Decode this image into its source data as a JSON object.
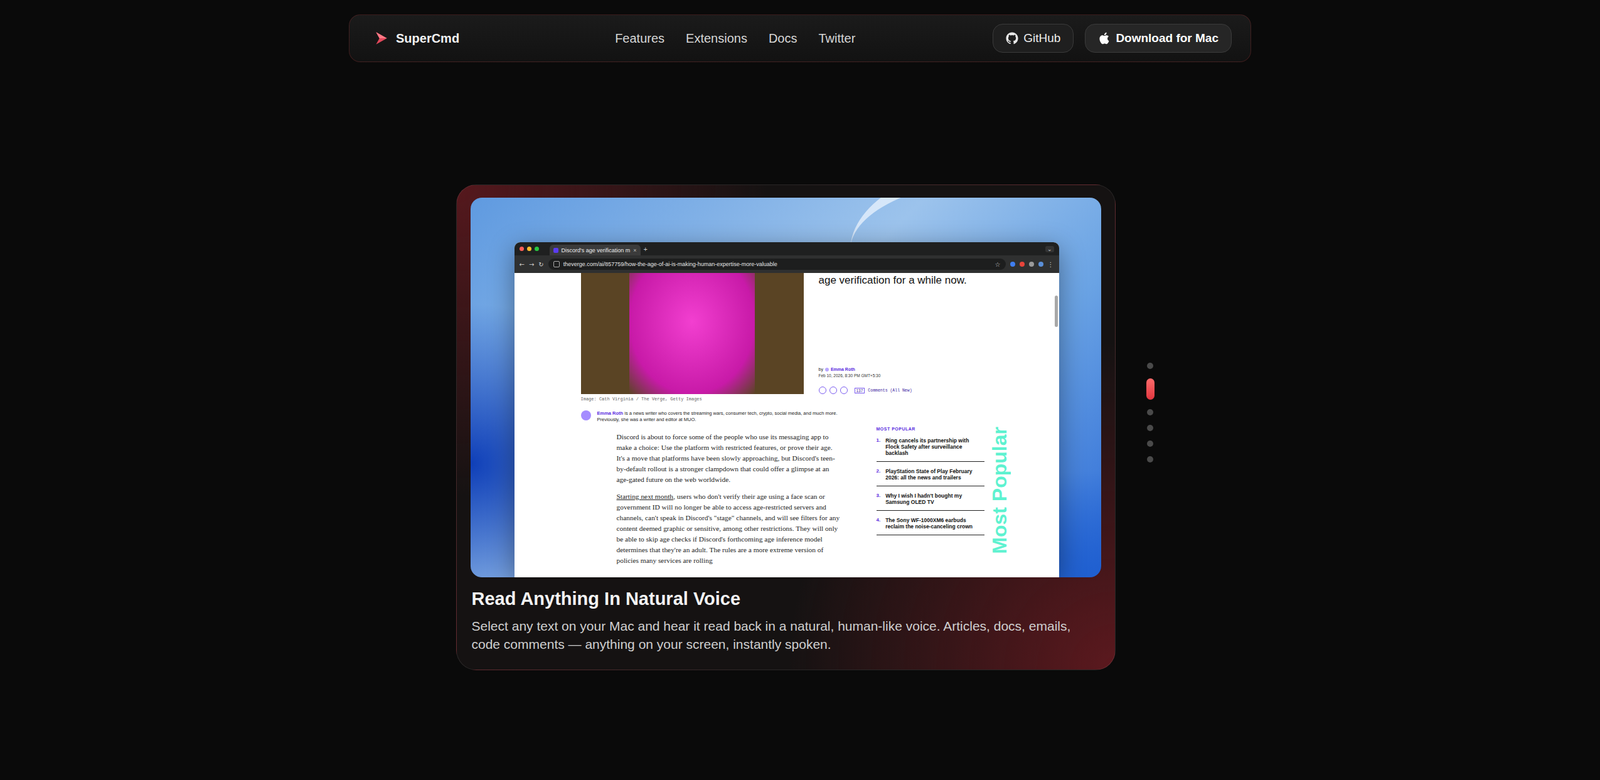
{
  "brand": {
    "name": "SuperCmd"
  },
  "nav": {
    "links": [
      "Features",
      "Extensions",
      "Docs",
      "Twitter"
    ]
  },
  "actions": [
    {
      "label": "GitHub",
      "kind": "github"
    },
    {
      "label": "Download for Mac",
      "kind": "download"
    }
  ],
  "slides": [
    {
      "selected": false
    },
    {
      "selected": true
    },
    {
      "selected": false
    },
    {
      "selected": false
    },
    {
      "selected": false
    },
    {
      "selected": false
    }
  ],
  "feature": {
    "title": "Read Anything In Natural Voice",
    "description": "Select any text on your Mac and hear it read back in a natural, human-like voice. Articles, docs, emails, code comments — anything on your screen, instantly spoken."
  },
  "browser": {
    "tab": {
      "title": "Discord's age verification m",
      "close": "×"
    },
    "new_tab": "+",
    "menu": "⌄",
    "nav_buttons": [
      "←",
      "→",
      "↻"
    ],
    "url": "theverge.com/ai/857759/how-the-age-of-ai-is-making-human-expertise-more-valuable",
    "bookmark": "☆",
    "more": "⋮",
    "article": {
      "headline_tail": "age verification for a while now.",
      "caption": "Image: Cath Virginia / The Verge, Getty Images",
      "byline_prefix": "by",
      "author": "Emma Roth",
      "date": "Feb 10, 2026, 8:30 PM GMT+5:30",
      "comments_count": "137",
      "comments_label": "Comments (All New)",
      "author_bio": "is a news writer who covers the streaming wars, consumer tech, crypto, social media, and much more. Previously, she was a writer and editor at MUO.",
      "paragraphs": [
        {
          "link": "",
          "text": "Discord is about to force some of the people who use its messaging app to make a choice: Use the platform with restricted features, or prove their age. It's a move that platforms have been slowly approaching, but Discord's teen-by-default rollout is a stronger clampdown that could offer a glimpse at an age-gated future on the web worldwide."
        },
        {
          "link": "Starting next month",
          "text": ", users who don't verify their age using a face scan or government ID will no longer be able to access age-restricted servers and channels, can't speak in Discord's \"stage\" channels, and will see filters for any content deemed graphic or sensitive, among other restrictions. They will only be able to skip age checks if Discord's forthcoming age inference model determines that they're an adult. The rules are a more extreme version of policies many services are rolling"
        }
      ],
      "most_popular": {
        "heading": "MOST POPULAR",
        "watermark": "Most Popular",
        "items": [
          {
            "rank": "1.",
            "title": "Ring cancels its partnership with Flock Safety after surveillance backlash"
          },
          {
            "rank": "2.",
            "title": "PlayStation State of Play February 2026: all the news and trailers"
          },
          {
            "rank": "3.",
            "title": "Why I wish I hadn't bought my Samsung OLED TV"
          },
          {
            "rank": "4.",
            "title": "The Sony WF-1000XM6 earbuds reclaim the noise-canceling crown"
          }
        ]
      }
    }
  }
}
